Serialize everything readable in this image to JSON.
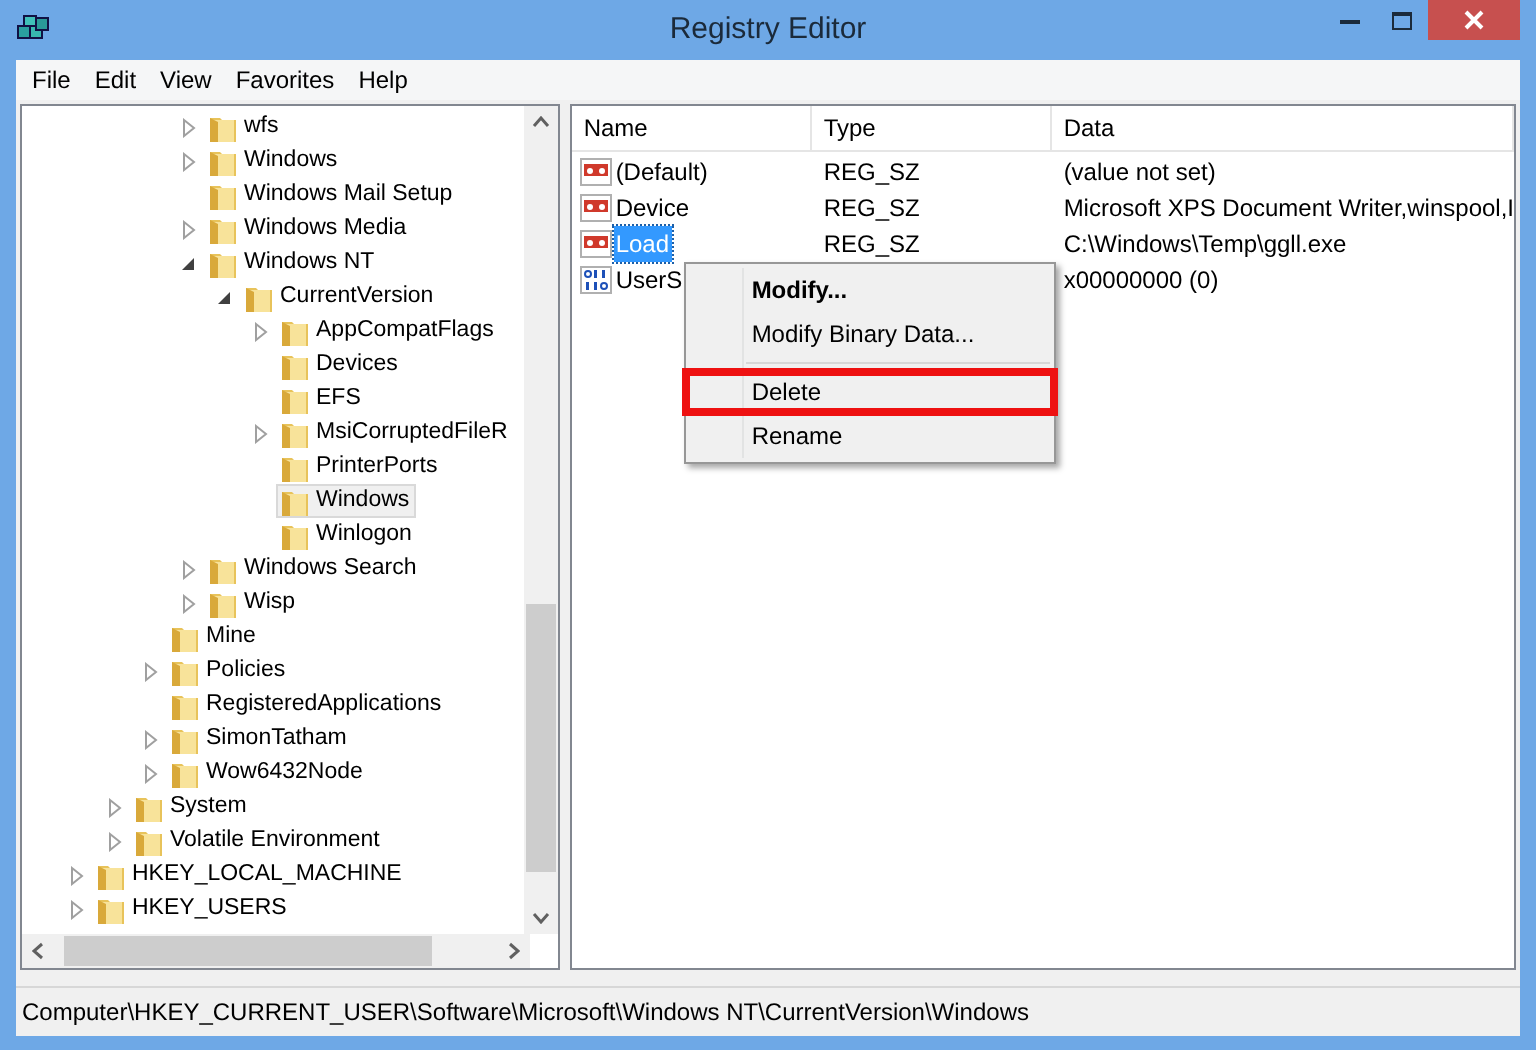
{
  "window": {
    "title": "Registry Editor"
  },
  "menu_bar": [
    "File",
    "Edit",
    "View",
    "Favorites",
    "Help"
  ],
  "tree": [
    {
      "children": [
        {
          "children": [
            {
              "children": [
                {
                  "label": "wfs",
                  "expandable": true,
                  "expanded": false,
                  "selected": false
                },
                {
                  "label": "Windows",
                  "expandable": true,
                  "expanded": false,
                  "selected": false
                },
                {
                  "label": "Windows Mail Setup",
                  "expandable": false,
                  "selected": false
                },
                {
                  "label": "Windows Media",
                  "expandable": true,
                  "expanded": false,
                  "selected": false
                },
                {
                  "label": "Windows NT",
                  "expandable": true,
                  "expanded": true,
                  "selected": false,
                  "children": [
                    {
                      "label": "CurrentVersion",
                      "expandable": true,
                      "expanded": true,
                      "selected": false,
                      "children": [
                        {
                          "label": "AppCompatFlags",
                          "expandable": true,
                          "expanded": false,
                          "selected": false
                        },
                        {
                          "label": "Devices",
                          "expandable": false,
                          "selected": false
                        },
                        {
                          "label": "EFS",
                          "expandable": false,
                          "selected": false
                        },
                        {
                          "label": "MsiCorruptedFileR",
                          "expandable": true,
                          "expanded": false,
                          "selected": false
                        },
                        {
                          "label": "PrinterPorts",
                          "expandable": false,
                          "selected": false
                        },
                        {
                          "label": "Windows",
                          "expandable": false,
                          "selected": true
                        },
                        {
                          "label": "Winlogon",
                          "expandable": false,
                          "selected": false
                        }
                      ]
                    }
                  ]
                },
                {
                  "label": "Windows Search",
                  "expandable": true,
                  "expanded": false,
                  "selected": false
                },
                {
                  "label": "Wisp",
                  "expandable": true,
                  "expanded": false,
                  "selected": false
                }
              ]
            },
            {
              "label": "Mine",
              "expandable": false,
              "selected": false
            },
            {
              "label": "Policies",
              "expandable": true,
              "expanded": false,
              "selected": false
            },
            {
              "label": "RegisteredApplications",
              "expandable": false,
              "selected": false
            },
            {
              "label": "SimonTatham",
              "expandable": true,
              "expanded": false,
              "selected": false
            },
            {
              "label": "Wow6432Node",
              "expandable": true,
              "expanded": false,
              "selected": false
            }
          ]
        },
        {
          "label": "System",
          "expandable": true,
          "expanded": false,
          "selected": false
        },
        {
          "label": "Volatile Environment",
          "expandable": true,
          "expanded": false,
          "selected": false
        }
      ]
    },
    {
      "label": "HKEY_LOCAL_MACHINE",
      "expandable": true,
      "expanded": false,
      "selected": false
    },
    {
      "label": "HKEY_USERS",
      "expandable": true,
      "expanded": false,
      "selected": false
    }
  ],
  "values": {
    "columns": [
      "Name",
      "Type",
      "Data"
    ],
    "rows": [
      {
        "kind": "string",
        "name": "(Default)",
        "type": "REG_SZ",
        "data": "(value not set)",
        "selected": false
      },
      {
        "kind": "string",
        "name": "Device",
        "type": "REG_SZ",
        "data": "Microsoft XPS Document Writer,winspool,I",
        "selected": false
      },
      {
        "kind": "string",
        "name": "Load",
        "type": "REG_SZ",
        "data": "C:\\Windows\\Temp\\ggll.exe",
        "selected": true
      },
      {
        "kind": "binary",
        "name": "UserS",
        "data": "x00000000 (0)",
        "selected": false
      }
    ]
  },
  "context_menu": [
    {
      "kind": "item",
      "label": "Modify...",
      "default": true,
      "highlighted": false
    },
    {
      "kind": "item",
      "label": "Modify Binary Data...",
      "default": false,
      "highlighted": false
    },
    {
      "kind": "separator"
    },
    {
      "kind": "item",
      "label": "Delete",
      "default": false,
      "highlighted": true
    },
    {
      "kind": "item",
      "label": "Rename",
      "default": false,
      "highlighted": false
    }
  ],
  "status_bar": "Computer\\HKEY_CURRENT_USER\\Software\\Microsoft\\Windows NT\\CurrentVersion\\Windows"
}
